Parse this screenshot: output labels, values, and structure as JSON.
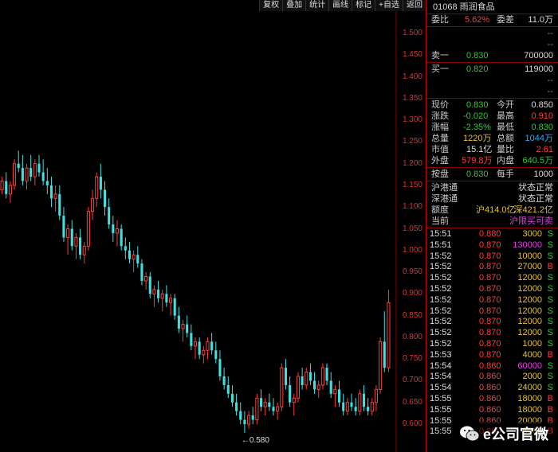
{
  "toolbar": [
    "复权",
    "叠加",
    "统计",
    "画线",
    "标记",
    "+自选",
    "返回"
  ],
  "stock": {
    "code_name": "01068 雨润食品"
  },
  "order_book": {
    "weibi_label": "委比",
    "weibi_value": "5.62%",
    "weicha_label": "委差",
    "weicha_value": "11.0万",
    "placeholder_a": "--",
    "placeholder_b": "--",
    "sell1_label": "卖一",
    "sell1_price": "0.830",
    "sell1_vol": "700000",
    "buy1_label": "买一",
    "buy1_price": "0.820",
    "buy1_vol": "119000",
    "placeholder_c": "--",
    "placeholder_d": "--"
  },
  "quote": {
    "now_label": "现价",
    "now": "0.830",
    "open_label": "今开",
    "open": "0.850",
    "chg_label": "涨跌",
    "chg": "-0.020",
    "high_label": "最高",
    "high": "0.910",
    "pct_label": "涨幅",
    "pct": "-2.35%",
    "low_label": "最低",
    "low": "0.830",
    "vol_label": "总量",
    "vol": "1220万",
    "amt_label": "总额",
    "amt": "1044万",
    "mcap_label": "市值",
    "mcap": "15.1亿",
    "ratio_label": "量比",
    "ratio": "2.61",
    "outer_label": "外盘",
    "outer": "579.8万",
    "inner_label": "内盘",
    "inner": "640.5万",
    "ask_label": "按盘",
    "ask": "0.830",
    "lot_label": "每手",
    "lot": "1000"
  },
  "connect": {
    "hk_sh_label": "沪港通",
    "hk_sh_status": "状态正常",
    "hk_sz_label": "深港通",
    "hk_sz_status": "状态正常",
    "quota_label": "额度",
    "quota_sh": "沪414.0亿",
    "quota_sz": "深421.2亿",
    "current_label": "当前",
    "current_status": "沪限买可卖"
  },
  "trades": [
    {
      "time": "15:51",
      "price": "0.880",
      "vol": "3000",
      "side": "S",
      "pc": "red",
      "vc": "yellow"
    },
    {
      "time": "15:51",
      "price": "0.870",
      "vol": "130000",
      "side": "S",
      "pc": "red",
      "vc": "magenta"
    },
    {
      "time": "15:52",
      "price": "0.870",
      "vol": "10000",
      "side": "S",
      "pc": "red",
      "vc": "yellow"
    },
    {
      "time": "15:52",
      "price": "0.870",
      "vol": "27000",
      "side": "B",
      "pc": "red",
      "vc": "yellow"
    },
    {
      "time": "15:52",
      "price": "0.870",
      "vol": "12000",
      "side": "S",
      "pc": "red",
      "vc": "yellow"
    },
    {
      "time": "15:52",
      "price": "0.870",
      "vol": "12000",
      "side": "S",
      "pc": "red",
      "vc": "yellow"
    },
    {
      "time": "15:52",
      "price": "0.870",
      "vol": "12000",
      "side": "S",
      "pc": "red",
      "vc": "yellow"
    },
    {
      "time": "15:52",
      "price": "0.870",
      "vol": "12000",
      "side": "S",
      "pc": "red",
      "vc": "yellow"
    },
    {
      "time": "15:52",
      "price": "0.870",
      "vol": "12000",
      "side": "S",
      "pc": "red",
      "vc": "yellow"
    },
    {
      "time": "15:52",
      "price": "0.870",
      "vol": "12000",
      "side": "S",
      "pc": "red",
      "vc": "yellow"
    },
    {
      "time": "15:52",
      "price": "0.870",
      "vol": "1000",
      "side": "S",
      "pc": "red",
      "vc": "yellow"
    },
    {
      "time": "15:53",
      "price": "0.870",
      "vol": "4000",
      "side": "B",
      "pc": "red",
      "vc": "yellow"
    },
    {
      "time": "15:54",
      "price": "0.860",
      "vol": "60000",
      "side": "S",
      "pc": "red",
      "vc": "magenta"
    },
    {
      "time": "15:54",
      "price": "0.860",
      "vol": "2000",
      "side": "S",
      "pc": "red",
      "vc": "yellow"
    },
    {
      "time": "15:54",
      "price": "0.860",
      "vol": "24000",
      "side": "S",
      "pc": "red",
      "vc": "yellow"
    },
    {
      "time": "15:55",
      "price": "0.860",
      "vol": "18000",
      "side": "B",
      "pc": "red",
      "vc": "yellow"
    },
    {
      "time": "15:55",
      "price": "0.860",
      "vol": "18000",
      "side": "B",
      "pc": "red",
      "vc": "yellow"
    },
    {
      "time": "15:55",
      "price": "0.860",
      "vol": "20000",
      "side": "B",
      "pc": "red",
      "vc": "yellow"
    },
    {
      "time": "15:55",
      "price": "0.860",
      "vol": "6000",
      "side": "B",
      "pc": "red",
      "vc": "yellow"
    }
  ],
  "chart_data": {
    "type": "candlestick",
    "y_ticks": [
      "1.500",
      "1.450",
      "1.400",
      "1.350",
      "1.300",
      "1.250",
      "1.200",
      "1.150",
      "1.100",
      "1.050",
      "1.000",
      "0.950",
      "0.900",
      "0.850",
      "0.800",
      "0.750",
      "0.700",
      "0.650",
      "0.600"
    ],
    "ylim": [
      0.565,
      1.525
    ],
    "low_annotation": "←0.580",
    "low_value": 0.58,
    "up_color": "#ff3d3d",
    "down_color": "#40e0e0",
    "candles": [
      [
        1.14,
        1.17,
        1.13,
        1.16
      ],
      [
        1.16,
        1.18,
        1.12,
        1.13
      ],
      [
        1.13,
        1.16,
        1.11,
        1.15
      ],
      [
        1.15,
        1.21,
        1.14,
        1.2
      ],
      [
        1.2,
        1.23,
        1.18,
        1.19
      ],
      [
        1.19,
        1.22,
        1.15,
        1.16
      ],
      [
        1.16,
        1.2,
        1.14,
        1.19
      ],
      [
        1.19,
        1.22,
        1.16,
        1.17
      ],
      [
        1.17,
        1.21,
        1.15,
        1.2
      ],
      [
        1.2,
        1.22,
        1.17,
        1.18
      ],
      [
        1.18,
        1.21,
        1.15,
        1.16
      ],
      [
        1.16,
        1.19,
        1.13,
        1.15
      ],
      [
        1.15,
        1.17,
        1.1,
        1.12
      ],
      [
        1.12,
        1.15,
        1.09,
        1.13
      ],
      [
        1.13,
        1.15,
        1.07,
        1.08
      ],
      [
        1.08,
        1.1,
        1.02,
        1.03
      ],
      [
        1.03,
        1.06,
        0.99,
        1.05
      ],
      [
        1.05,
        1.07,
        1.0,
        1.01
      ],
      [
        1.01,
        1.04,
        0.98,
        1.03
      ],
      [
        1.03,
        1.05,
        0.98,
        0.99
      ],
      [
        0.99,
        1.02,
        0.97,
        1.01
      ],
      [
        1.01,
        1.1,
        1.0,
        1.09
      ],
      [
        1.09,
        1.14,
        1.07,
        1.12
      ],
      [
        1.12,
        1.18,
        1.1,
        1.17
      ],
      [
        1.17,
        1.2,
        1.12,
        1.14
      ],
      [
        1.14,
        1.16,
        1.08,
        1.1
      ],
      [
        1.1,
        1.12,
        1.05,
        1.06
      ],
      [
        1.06,
        1.08,
        1.02,
        1.04
      ],
      [
        1.04,
        1.07,
        1.01,
        1.05
      ],
      [
        1.05,
        1.06,
        1.0,
        1.01
      ],
      [
        1.01,
        1.03,
        0.98,
        1.0
      ],
      [
        1.0,
        1.02,
        0.97,
        0.98
      ],
      [
        0.98,
        1.0,
        0.95,
        0.99
      ],
      [
        0.99,
        1.01,
        0.96,
        0.97
      ],
      [
        0.97,
        0.98,
        0.92,
        0.93
      ],
      [
        0.93,
        0.95,
        0.91,
        0.94
      ],
      [
        0.94,
        0.95,
        0.89,
        0.9
      ],
      [
        0.9,
        0.92,
        0.87,
        0.91
      ],
      [
        0.91,
        0.93,
        0.88,
        0.89
      ],
      [
        0.89,
        0.91,
        0.86,
        0.9
      ],
      [
        0.9,
        0.92,
        0.87,
        0.88
      ],
      [
        0.88,
        0.9,
        0.85,
        0.89
      ],
      [
        0.89,
        0.9,
        0.84,
        0.85
      ],
      [
        0.85,
        0.87,
        0.81,
        0.82
      ],
      [
        0.82,
        0.84,
        0.79,
        0.83
      ],
      [
        0.83,
        0.85,
        0.8,
        0.81
      ],
      [
        0.81,
        0.83,
        0.77,
        0.78
      ],
      [
        0.78,
        0.8,
        0.75,
        0.79
      ],
      [
        0.79,
        0.8,
        0.75,
        0.76
      ],
      [
        0.76,
        0.78,
        0.74,
        0.77
      ],
      [
        0.77,
        0.8,
        0.75,
        0.79
      ],
      [
        0.79,
        0.81,
        0.76,
        0.77
      ],
      [
        0.77,
        0.79,
        0.74,
        0.75
      ],
      [
        0.75,
        0.77,
        0.7,
        0.71
      ],
      [
        0.71,
        0.73,
        0.68,
        0.69
      ],
      [
        0.69,
        0.71,
        0.66,
        0.67
      ],
      [
        0.67,
        0.69,
        0.64,
        0.65
      ],
      [
        0.65,
        0.67,
        0.62,
        0.63
      ],
      [
        0.63,
        0.65,
        0.6,
        0.61
      ],
      [
        0.61,
        0.63,
        0.58,
        0.6
      ],
      [
        0.6,
        0.63,
        0.59,
        0.62
      ],
      [
        0.62,
        0.64,
        0.6,
        0.61
      ],
      [
        0.61,
        0.67,
        0.6,
        0.66
      ],
      [
        0.66,
        0.68,
        0.63,
        0.64
      ],
      [
        0.64,
        0.66,
        0.62,
        0.65
      ],
      [
        0.65,
        0.67,
        0.63,
        0.64
      ],
      [
        0.64,
        0.66,
        0.62,
        0.63
      ],
      [
        0.63,
        0.65,
        0.61,
        0.64
      ],
      [
        0.64,
        0.74,
        0.63,
        0.73
      ],
      [
        0.73,
        0.75,
        0.68,
        0.69
      ],
      [
        0.69,
        0.71,
        0.64,
        0.65
      ],
      [
        0.65,
        0.67,
        0.62,
        0.66
      ],
      [
        0.66,
        0.72,
        0.65,
        0.71
      ],
      [
        0.71,
        0.73,
        0.68,
        0.69
      ],
      [
        0.69,
        0.73,
        0.68,
        0.72
      ],
      [
        0.72,
        0.74,
        0.69,
        0.7
      ],
      [
        0.7,
        0.72,
        0.67,
        0.68
      ],
      [
        0.68,
        0.7,
        0.66,
        0.69
      ],
      [
        0.69,
        0.74,
        0.68,
        0.73
      ],
      [
        0.73,
        0.74,
        0.69,
        0.7
      ],
      [
        0.7,
        0.72,
        0.66,
        0.67
      ],
      [
        0.67,
        0.69,
        0.64,
        0.68
      ],
      [
        0.68,
        0.7,
        0.64,
        0.65
      ],
      [
        0.65,
        0.67,
        0.62,
        0.63
      ],
      [
        0.63,
        0.66,
        0.62,
        0.65
      ],
      [
        0.65,
        0.67,
        0.63,
        0.64
      ],
      [
        0.64,
        0.66,
        0.62,
        0.63
      ],
      [
        0.63,
        0.68,
        0.62,
        0.67
      ],
      [
        0.67,
        0.69,
        0.63,
        0.64
      ],
      [
        0.64,
        0.66,
        0.62,
        0.63
      ],
      [
        0.63,
        0.66,
        0.62,
        0.65
      ],
      [
        0.65,
        0.69,
        0.63,
        0.68
      ],
      [
        0.68,
        0.8,
        0.67,
        0.79
      ],
      [
        0.79,
        0.86,
        0.72,
        0.73
      ],
      [
        0.73,
        0.91,
        0.72,
        0.88
      ]
    ]
  }
}
